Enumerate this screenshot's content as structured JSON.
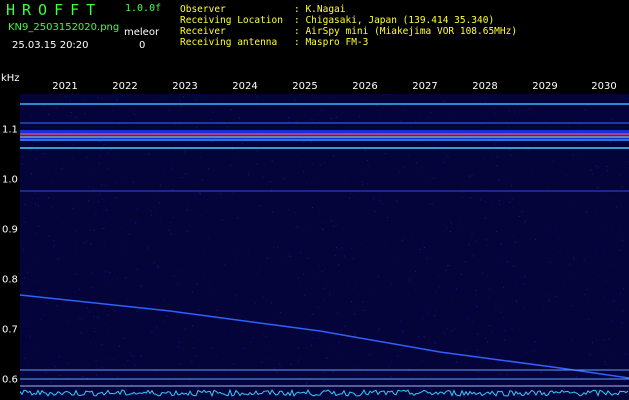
{
  "header": {
    "app_title": "HROFFT",
    "version": "1.0.0f",
    "filename": "KN9_2503152020.png",
    "datetime": "25.03.15 20:20",
    "meleor_label": "meleor",
    "meleor_count": "0"
  },
  "info": {
    "observer_label": "Observer",
    "observer_value": ": K.Nagai",
    "location_label": "Receiving Location",
    "location_value": ": Chigasaki, Japan (139.414 35.340)",
    "receiver_label": "Receiver",
    "receiver_value": ": AirSpy mini (Miakejima VOR 108.65MHz)",
    "antenna_label": "Receiving antenna",
    "antenna_value": ": Maspro FM-3"
  },
  "axis": {
    "unit": "kHz",
    "years": [
      "2021",
      "2022",
      "2023",
      "2024",
      "2025",
      "2026",
      "2027",
      "2028",
      "2029",
      "2030"
    ],
    "freq_ticks": [
      "1.1",
      "1.0",
      "0.9",
      "0.8",
      "0.7",
      "0.6"
    ]
  },
  "colors": {
    "title_green": "#3cff3c",
    "label_yellow": "#ffff33",
    "background": "#000000",
    "noise_blue": "#0a0a8c",
    "cyan": "#33ccff"
  }
}
